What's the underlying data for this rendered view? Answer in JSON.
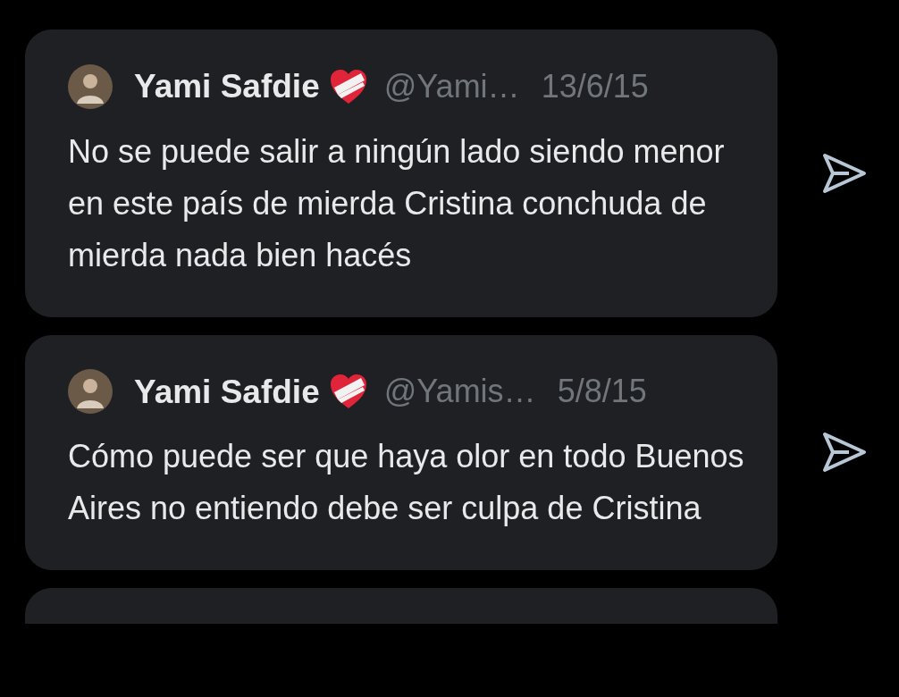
{
  "messages": [
    {
      "author": "Yami Safdie",
      "handle": "@Yami…",
      "date": "13/6/15",
      "text": "No se puede salir a ningún lado siendo menor en este país de mierda Cristina conchuda de mierda nada bien hacés"
    },
    {
      "author": "Yami Safdie",
      "handle": "@Yamis…",
      "date": "5/8/15",
      "text": "Cómo puede ser que haya olor en todo Buenos Aires no entiendo debe ser culpa de Cristina"
    }
  ]
}
